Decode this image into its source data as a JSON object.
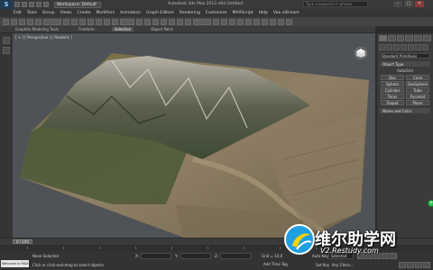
{
  "titlebar": {
    "app_logo": "S",
    "workspace": "Workspace: Default",
    "window_title": "Autodesk 3ds Max 2013 x64     Untitled",
    "search_placeholder": "Type a keyword or phrase"
  },
  "menu": [
    "Edit",
    "Tools",
    "Group",
    "Views",
    "Create",
    "Modifiers",
    "Animation",
    "Graph Editors",
    "Rendering",
    "Customize",
    "MAXScript",
    "Help",
    "Vue xStream"
  ],
  "ribbon": {
    "tabs": [
      "Graphite Modeling Tools",
      "Freeform",
      "Selection",
      "Object Paint"
    ],
    "active_index": 2
  },
  "viewport": {
    "label": "[ + ] [ Perspective ] [ Realistic ]"
  },
  "command_panel": {
    "dropdown_value": "Standard Primitives",
    "object_type_title": "Object Type",
    "autogrid_label": "AutoGrid",
    "object_buttons": [
      "Box",
      "Cone",
      "Sphere",
      "GeoSphere",
      "Cylinder",
      "Tube",
      "Torus",
      "Pyramid",
      "Teapot",
      "Plane"
    ],
    "name_color_title": "Name and Color"
  },
  "timeline": {
    "frame_display": "0 / 100"
  },
  "status": {
    "maxscript_prompt": "Welcome to MAX",
    "selection_text": "None Selected",
    "prompt_text": "Click or click-and-drag to select objects",
    "x_label": "X:",
    "y_label": "Y:",
    "z_label": "Z:",
    "grid_text": "Grid = 10.0",
    "auto_key": "Auto Key",
    "selected_value": "Selected",
    "set_key": "Set Key",
    "key_filters": "Key Filters...",
    "add_time_tag": "Add Time Tag"
  },
  "watermark": {
    "title": "维尔助学网",
    "url": "V2.Restudy.com"
  },
  "colors": {
    "sky": "#4f5256",
    "terrain_green": "#4b5a3a",
    "terrain_brown": "#8b7a63",
    "accent_blue": "#1f9fe2"
  }
}
